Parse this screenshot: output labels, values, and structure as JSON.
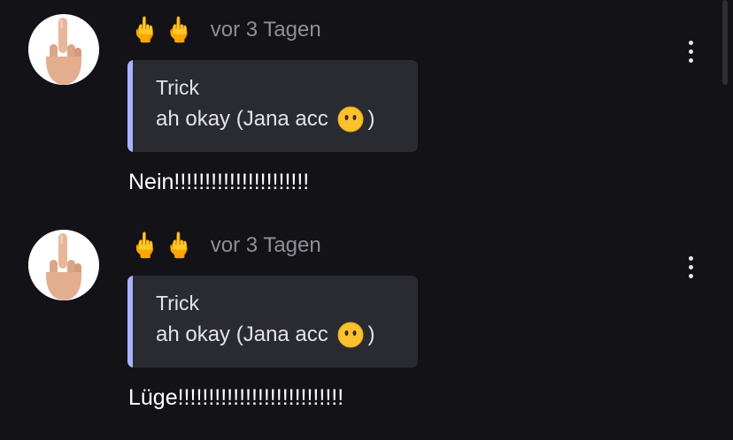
{
  "messages": [
    {
      "user_name": "🖕🖕",
      "timestamp": "vor 3 Tagen",
      "quote": {
        "author": "Trick",
        "text_before": "ah okay (Jana acc ",
        "emoji": "face-without-mouth-emoji",
        "text_after": ")"
      },
      "body": "Nein!!!!!!!!!!!!!!!!!!!!!!"
    },
    {
      "user_name": "🖕🖕",
      "timestamp": "vor 3 Tagen",
      "quote": {
        "author": "Trick",
        "text_before": "ah okay (Jana acc ",
        "emoji": "face-without-mouth-emoji",
        "text_after": ")"
      },
      "body": "Lüge!!!!!!!!!!!!!!!!!!!!!!!!!!!"
    }
  ],
  "icons": {
    "avatar": "middle-finger-hand-icon",
    "more": "more-vertical-icon"
  },
  "colors": {
    "background": "#121217",
    "quote_background": "#2a2a31",
    "quote_bar": "#a9b3ff",
    "timestamp": "#8e8e96"
  }
}
